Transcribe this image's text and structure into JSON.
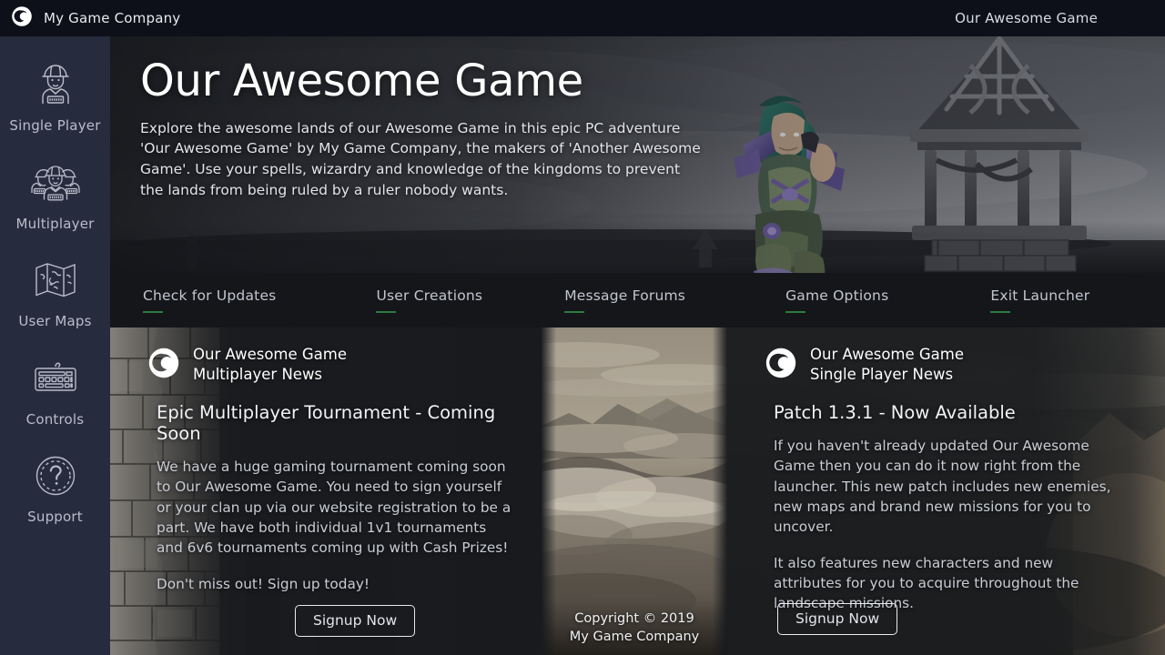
{
  "topbar": {
    "logo_icon": "company-ring-logo-icon",
    "company": "My Game Company",
    "game_title": "Our Awesome Game"
  },
  "sidebar": {
    "items": [
      {
        "label": "Single Player",
        "icon": "single-worker-icon"
      },
      {
        "label": "Multiplayer",
        "icon": "multiple-workers-icon"
      },
      {
        "label": "User Maps",
        "icon": "folded-map-icon"
      },
      {
        "label": "Controls",
        "icon": "keyboard-icon"
      },
      {
        "label": "Support",
        "icon": "question-mark-circle-icon"
      }
    ]
  },
  "hero": {
    "title": "Our Awesome Game",
    "description": "Explore the awesome lands of our Awesome Game in this epic PC adventure 'Our Awesome Game' by My Game Company, the makers of 'Another Awesome Game'. Use your spells, wizardry and knowledge of the kingdoms to prevent the lands from being ruled by a ruler nobody wants."
  },
  "nav": {
    "items": [
      "Check for Updates",
      "User Creations",
      "Message Forums",
      "Game Options",
      "Exit Launcher"
    ],
    "underline_color": "#2f7a3f"
  },
  "panels": {
    "multiplayer": {
      "logo_icon": "company-ring-logo-icon",
      "head_line1": "Our Awesome Game",
      "head_line2": "Multiplayer News",
      "title": "Epic Multiplayer Tournament - Coming Soon",
      "paragraph1": "We have a huge gaming tournament coming soon to Our Awesome Game. You need to sign yourself or your clan up via our website registration to be a part. We have both individual 1v1 tournaments and 6v6 tournaments coming up with Cash Prizes!",
      "paragraph2": "Don't miss out! Sign up today!",
      "button": "Signup Now"
    },
    "middle": {
      "copyright_line1": "Copyright © 2019",
      "copyright_line2": "My Game Company"
    },
    "singleplayer": {
      "logo_icon": "company-ring-logo-icon",
      "head_line1": "Our Awesome Game",
      "head_line2": "Single Player News",
      "title": "Patch 1.3.1 - Now Available",
      "paragraph1": "If you haven't already updated Our Awesome Game then you can do it now right from the launcher. This new patch includes new enemies, new maps and brand new missions for you to uncover.",
      "paragraph2": "It also features new characters and new attributes for you to acquire throughout the landscape missions.",
      "button": "Signup Now"
    }
  },
  "theme": {
    "topbar_bg": "#0d1019",
    "sidebar_bg": "#262b3e",
    "navbar_bg": "#14161a",
    "accent_green": "#2f7a3f",
    "text_light": "#e8eaf0"
  }
}
